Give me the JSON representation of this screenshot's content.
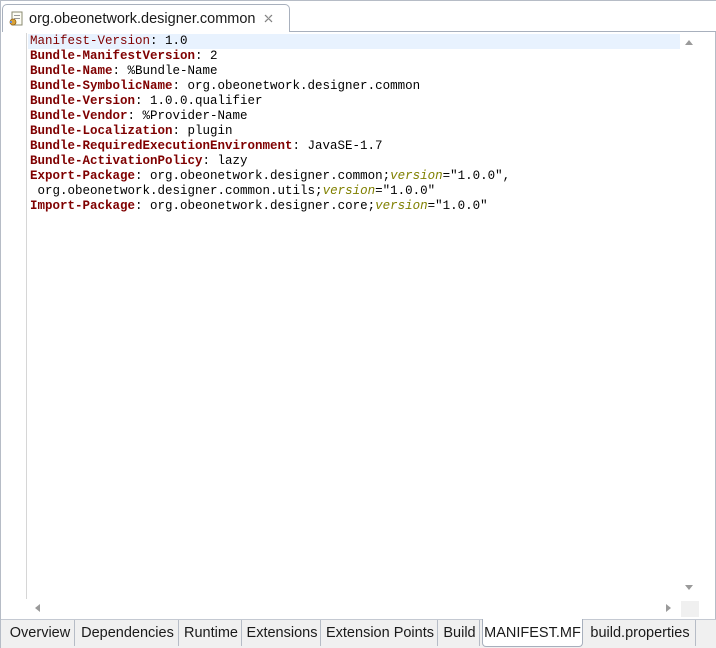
{
  "editor_tab": {
    "title": "org.obeonetwork.designer.common",
    "icon": "plugin-manifest-icon",
    "close_icon": "close-icon"
  },
  "manifest": {
    "lines": [
      [
        {
          "t": "Manifest-Version",
          "s": "hdr-plain"
        },
        {
          "t": ": 1.0",
          "s": "plain"
        }
      ],
      [
        {
          "t": "Bundle-ManifestVersion",
          "s": "hdr"
        },
        {
          "t": ": 2",
          "s": "plain"
        }
      ],
      [
        {
          "t": "Bundle-Name",
          "s": "hdr"
        },
        {
          "t": ": %Bundle-Name",
          "s": "plain"
        }
      ],
      [
        {
          "t": "Bundle-SymbolicName",
          "s": "hdr"
        },
        {
          "t": ": org.obeonetwork.designer.common",
          "s": "plain"
        }
      ],
      [
        {
          "t": "Bundle-Version",
          "s": "hdr"
        },
        {
          "t": ": 1.0.0.qualifier",
          "s": "plain"
        }
      ],
      [
        {
          "t": "Bundle-Vendor",
          "s": "hdr"
        },
        {
          "t": ": %Provider-Name",
          "s": "plain"
        }
      ],
      [
        {
          "t": "Bundle-Localization",
          "s": "hdr"
        },
        {
          "t": ": plugin",
          "s": "plain"
        }
      ],
      [
        {
          "t": "Bundle-RequiredExecutionEnvironment",
          "s": "hdr"
        },
        {
          "t": ": JavaSE-1.7",
          "s": "plain"
        }
      ],
      [
        {
          "t": "Bundle-ActivationPolicy",
          "s": "hdr"
        },
        {
          "t": ": lazy",
          "s": "plain"
        }
      ],
      [
        {
          "t": "Export-Package",
          "s": "hdr"
        },
        {
          "t": ": org.obeonetwork.designer.common;",
          "s": "plain"
        },
        {
          "t": "version",
          "s": "attr"
        },
        {
          "t": "=\"1.0.0\",",
          "s": "plain"
        }
      ],
      [
        {
          "t": " org.obeonetwork.designer.common.utils;",
          "s": "plain"
        },
        {
          "t": "version",
          "s": "attr"
        },
        {
          "t": "=\"1.0.0\"",
          "s": "plain"
        }
      ],
      [
        {
          "t": "Import-Package",
          "s": "hdr"
        },
        {
          "t": ": org.obeonetwork.designer.core;",
          "s": "plain"
        },
        {
          "t": "version",
          "s": "attr"
        },
        {
          "t": "=\"1.0.0\"",
          "s": "plain"
        }
      ]
    ]
  },
  "page_tabs": [
    {
      "label": "Overview",
      "active": false
    },
    {
      "label": "Dependencies",
      "active": false
    },
    {
      "label": "Runtime",
      "active": false
    },
    {
      "label": "Extensions",
      "active": false
    },
    {
      "label": "Extension Points",
      "active": false
    },
    {
      "label": "Build",
      "active": false
    },
    {
      "label": "MANIFEST.MF",
      "active": true
    },
    {
      "label": "build.properties",
      "active": false
    }
  ],
  "colors": {
    "header_key": "#7f0000",
    "attribute": "#808000",
    "current_line": "#e8f2fe"
  }
}
